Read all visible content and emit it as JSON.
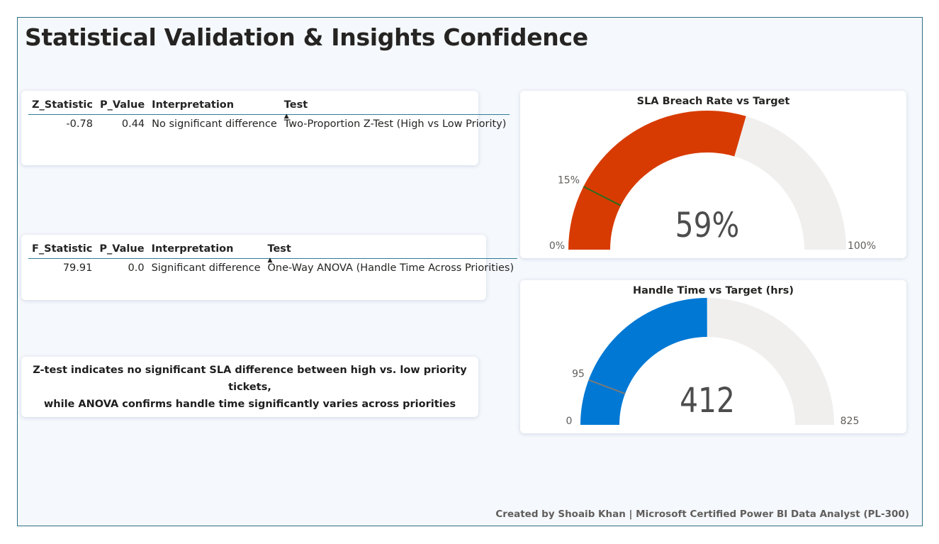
{
  "page": {
    "title": "Statistical Validation & Insights Confidence",
    "footer": "Created by Shoaib Khan | Microsoft Certified Power BI Data Analyst (PL-300)"
  },
  "z_table": {
    "headers": [
      "Z_Statistic",
      "P_Value",
      "Interpretation",
      "Test"
    ],
    "rows": [
      [
        "-0.78",
        "0.44",
        "No significant difference",
        "Two-Proportion Z-Test (High vs Low Priority)"
      ]
    ]
  },
  "f_table": {
    "headers": [
      "F_Statistic",
      "P_Value",
      "Interpretation",
      "Test"
    ],
    "rows": [
      [
        "79.91",
        "0.0",
        "Significant difference",
        "One-Way ANOVA (Handle Time Across Priorities)"
      ]
    ]
  },
  "sort_indicator": "▲",
  "note": {
    "line1": "Z-test indicates no significant SLA difference between high vs. low priority tickets,",
    "line2": "while ANOVA confirms handle time significantly varies across priorities"
  },
  "chart_data": [
    {
      "type": "gauge",
      "title": "SLA Breach Rate vs Target",
      "value": 59,
      "value_label": "59%",
      "min": 0,
      "min_label": "0%",
      "max": 100,
      "max_label": "100%",
      "target": 15,
      "target_label": "15%",
      "fill_color": "#d83b01",
      "track_color": "#f0efee",
      "target_color": "#2e6b1e"
    },
    {
      "type": "gauge",
      "title": "Handle Time vs Target (hrs)",
      "value": 412,
      "value_label": "412",
      "min": 0,
      "min_label": "0",
      "max": 825,
      "max_label": "825",
      "target": 95,
      "target_label": "95",
      "fill_color": "#0078d4",
      "track_color": "#f0efee",
      "target_color": "#7a7a7a"
    }
  ]
}
